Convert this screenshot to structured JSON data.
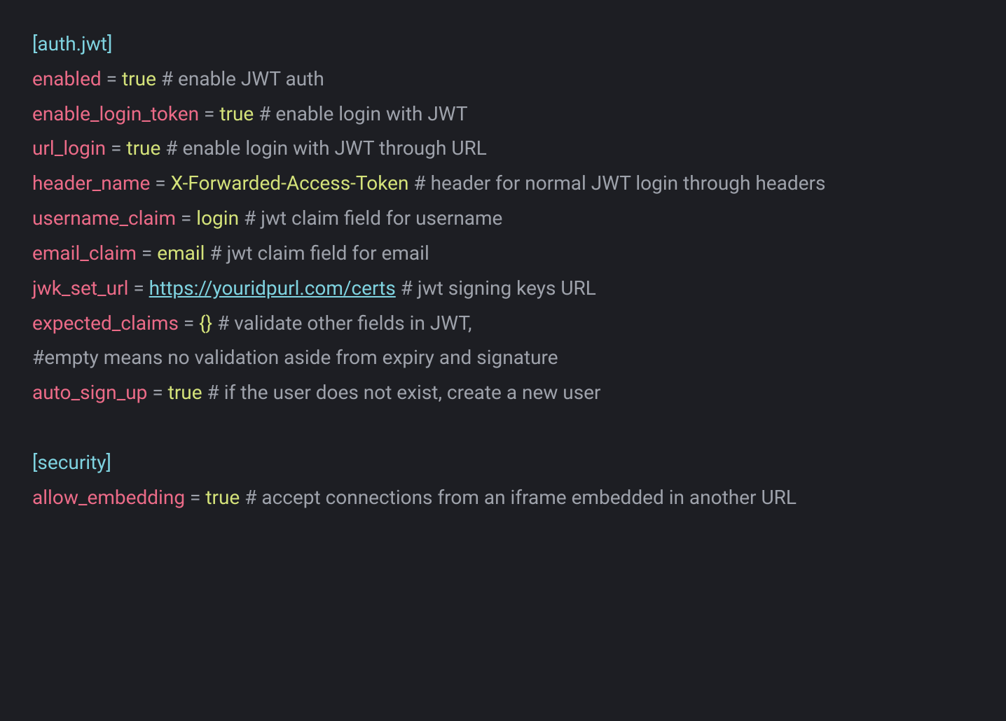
{
  "colors": {
    "bg": "#1d1e23",
    "section": "#7fd3e0",
    "key": "#ec6b88",
    "value": "#d4e27a",
    "comment": "#9ea2ab",
    "link": "#7fd3e0"
  },
  "sections": {
    "auth_jwt": {
      "header": "[auth.jwt]",
      "items": {
        "enabled": {
          "key": "enabled",
          "op": " = ",
          "value": "true",
          "comment": " # enable JWT auth"
        },
        "enable_login_token": {
          "key": "enable_login_token",
          "op": " = ",
          "value": "true",
          "comment": " # enable login with JWT"
        },
        "url_login": {
          "key": "url_login",
          "op": " =  ",
          "value": "true ",
          "comment": " # enable login with JWT through URL"
        },
        "header_name": {
          "key": "header_name",
          "op": " = ",
          "value": "X-Forwarded-Access-Token",
          "comment": " # header for normal JWT login through headers"
        },
        "username_claim": {
          "key": "username_claim",
          "op": " = ",
          "value": "login",
          "comment": " # jwt claim field for username"
        },
        "email_claim": {
          "key": "email_claim",
          "op": " = ",
          "value": "email",
          "comment": " # jwt claim field for email"
        },
        "jwk_set_url": {
          "key": "jwk_set_url",
          "op": " = ",
          "link_text": "https://youridpurl.com/certs",
          "link_href": "https://youridpurl.com/certs",
          "comment": " # jwt signing keys URL"
        },
        "expected_claims": {
          "key": "expected_claims",
          "op": " = ",
          "value": "{}",
          "comment": " # validate other fields in JWT,"
        },
        "expected_claims_note": {
          "comment": "#empty means no validation aside from expiry and signature"
        },
        "auto_sign_up": {
          "key": "auto_sign_up",
          "op": " = ",
          "value": "true",
          "comment": " # if the user does not exist, create a new user"
        }
      }
    },
    "security": {
      "header": "[security]",
      "items": {
        "allow_embedding": {
          "key": "allow_embedding",
          "op": " = ",
          "value": "true",
          "comment": " # accept connections from an iframe embedded in another URL"
        }
      }
    }
  }
}
